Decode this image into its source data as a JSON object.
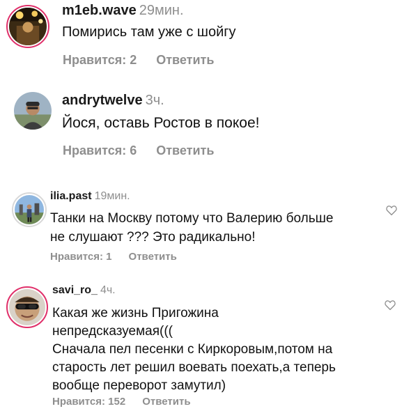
{
  "comments": [
    {
      "username": "m1eb.wave",
      "time": "29мин.",
      "text": [
        "Помирись там уже с шойгу"
      ],
      "likes_label": "Нравится: 2",
      "reply_label": "Ответить"
    },
    {
      "username": "andrytwelve",
      "time": "3ч.",
      "text": [
        "Йося, оставь Ростов в покое!"
      ],
      "likes_label": "Нравится: 6",
      "reply_label": "Ответить"
    },
    {
      "username": "ilia.past",
      "time": "19мин.",
      "text": [
        "Танки на Москву потому что Валерию больше",
        "не слушают ??? Это радикально!"
      ],
      "likes_label": "Нравится: 1",
      "reply_label": "Ответить"
    },
    {
      "username": "savi_ro_",
      "time": "4ч.",
      "text": [
        "Какая же жизнь Пригожина",
        "непредсказуемая(((",
        "Сначала пел песенки с Киркоровым,потом на",
        "старость лет решил воевать поехать,а теперь",
        "вообще переворот замутил)"
      ],
      "likes_label": "Нравится: 152",
      "reply_label": "Ответить"
    }
  ],
  "icons": {
    "like": "heart-outline-icon"
  },
  "colors": {
    "story_ring": "#e0306a",
    "meta_gray": "#8e8e8e"
  }
}
